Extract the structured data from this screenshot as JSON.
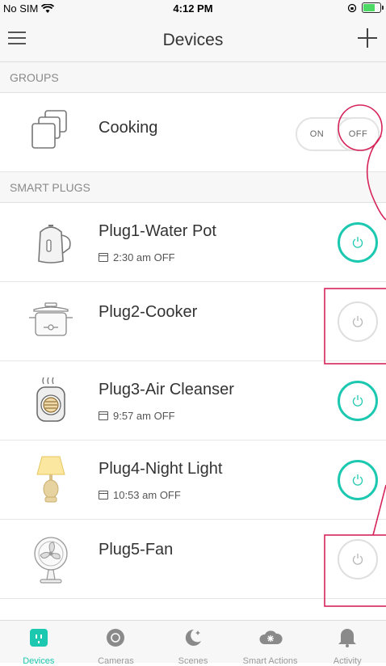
{
  "status": {
    "carrier": "No SIM",
    "time": "4:12 PM"
  },
  "nav": {
    "title": "Devices"
  },
  "groups": {
    "header": "GROUPS",
    "items": [
      {
        "name": "Cooking",
        "on_label": "ON",
        "off_label": "OFF",
        "state": "off"
      }
    ]
  },
  "plugs": {
    "header": "SMART PLUGS",
    "items": [
      {
        "name": "Plug1-Water Pot",
        "schedule": "2:30 am OFF",
        "state": "on",
        "icon": "kettle-icon"
      },
      {
        "name": "Plug2-Cooker",
        "schedule": "",
        "state": "off",
        "icon": "cooker-icon"
      },
      {
        "name": "Plug3-Air Cleanser",
        "schedule": "9:57 am OFF",
        "state": "on",
        "icon": "air-cleanser-icon"
      },
      {
        "name": "Plug4-Night Light",
        "schedule": "10:53 am OFF",
        "state": "on",
        "icon": "lamp-icon"
      },
      {
        "name": "Plug5-Fan",
        "schedule": "",
        "state": "off",
        "icon": "fan-icon"
      }
    ]
  },
  "tabs": [
    {
      "label": "Devices",
      "active": true
    },
    {
      "label": "Cameras",
      "active": false
    },
    {
      "label": "Scenes",
      "active": false
    },
    {
      "label": "Smart Actions",
      "active": false
    },
    {
      "label": "Activity",
      "active": false
    }
  ],
  "colors": {
    "accent": "#1cc8b0",
    "annotation": "#d6245a"
  }
}
